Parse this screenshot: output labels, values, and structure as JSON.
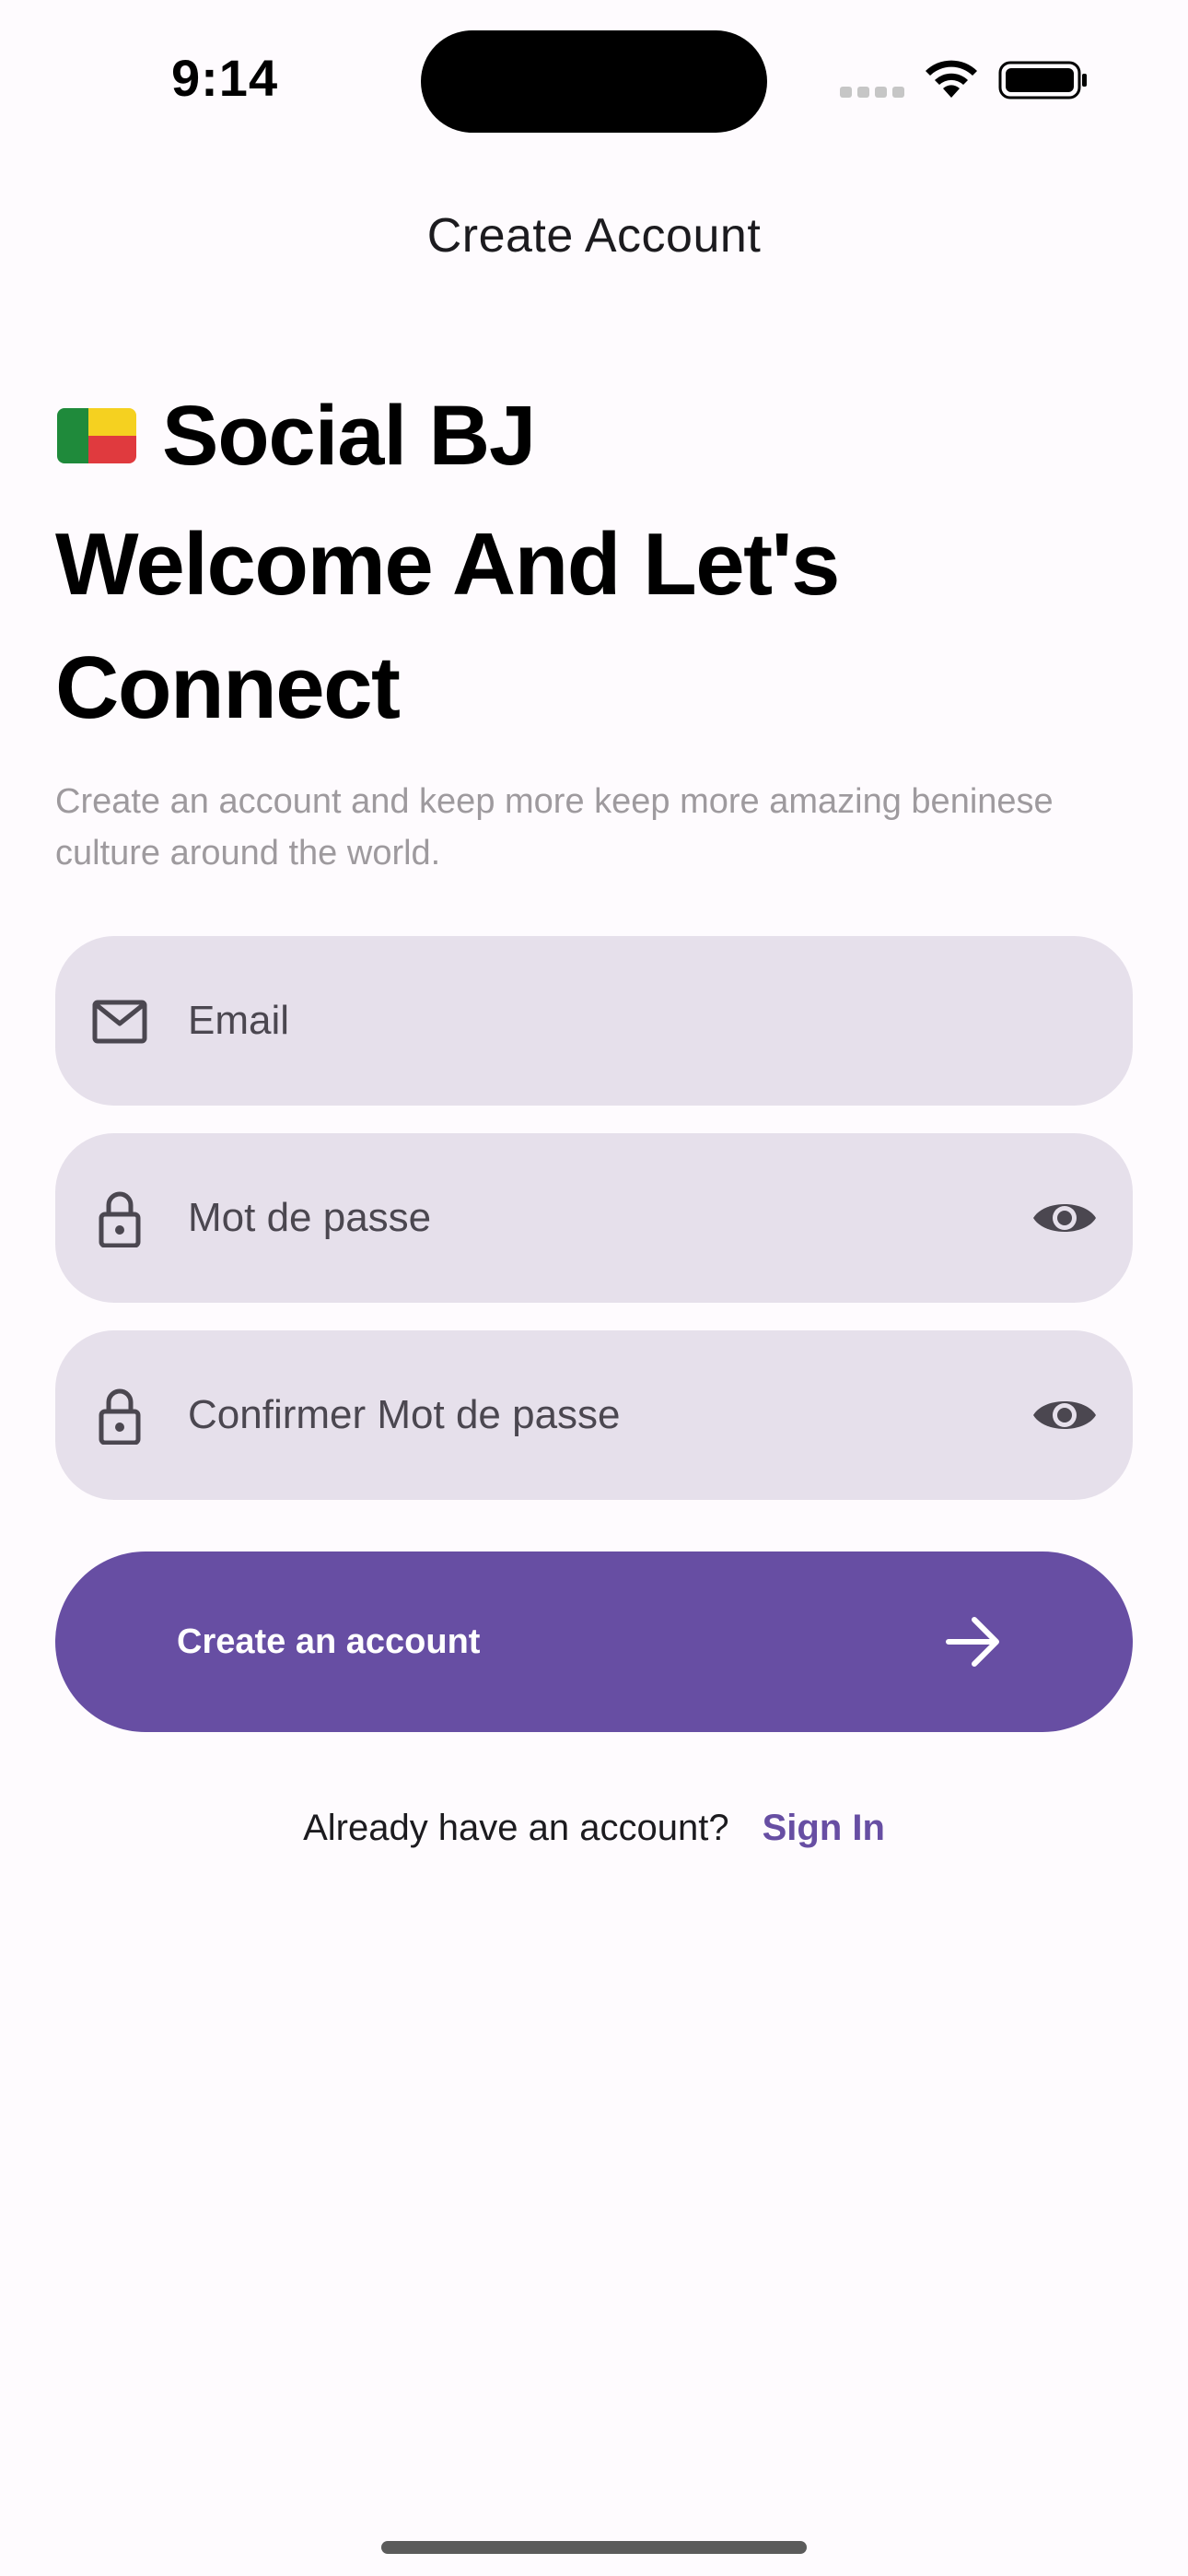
{
  "status_bar": {
    "time": "9:14"
  },
  "header": {
    "title": "Create Account"
  },
  "brand": {
    "name": "Social BJ",
    "flag_icon": "benin-flag-icon"
  },
  "welcome": {
    "headline_line1": "Welcome And Let's",
    "headline_line2": "Connect",
    "subtitle": "Create an account and keep more keep more amazing beninese culture around the world."
  },
  "form": {
    "email": {
      "placeholder": "Email",
      "icon": "mail-icon"
    },
    "password": {
      "placeholder": "Mot de passe",
      "icon": "lock-icon",
      "toggle_icon": "eye-icon"
    },
    "confirm_password": {
      "placeholder": "Confirmer Mot de passe",
      "icon": "lock-icon",
      "toggle_icon": "eye-icon"
    }
  },
  "actions": {
    "create_label": "Create an account",
    "create_icon": "arrow-right-icon"
  },
  "footer": {
    "question": "Already have an account?",
    "signin_label": "Sign In"
  },
  "colors": {
    "accent": "#674ea3",
    "field_bg": "#e6e0eb",
    "background": "#fefbfe"
  }
}
